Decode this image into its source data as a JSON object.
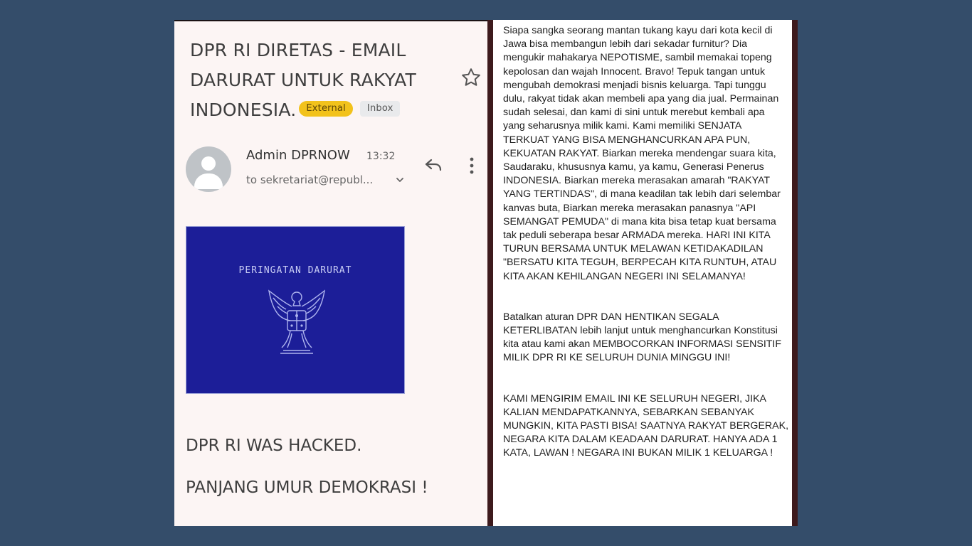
{
  "email": {
    "subject_lines": [
      "DPR RI DIRETAS - EMAIL",
      "DARURAT UNTUK RAKYAT",
      "INDONESIA."
    ],
    "label_external": "External",
    "label_inbox": "Inbox",
    "sender_name": "Admin DPRNOW",
    "time": "13:32",
    "recipient": "to sekretariat@republ...",
    "image_caption": "PERINGATAN DARURAT",
    "body_line1": "DPR RI WAS HACKED.",
    "body_line2": "PANJANG UMUR DEMOKRASI !"
  },
  "icons": {
    "star": "star-icon",
    "reply": "reply-icon",
    "more": "more-vertical-icon",
    "expand": "chevron-down-icon",
    "avatar": "avatar-placeholder"
  },
  "colors": {
    "background": "#344d6a",
    "external_badge": "#f2c21b",
    "warning_blue": "#1c1e98"
  },
  "manifesto": {
    "paragraph1": "Siapa sangka seorang mantan tukang kayu dari kota kecil di Jawa bisa membangun lebih dari sekadar furnitur? Dia mengukir mahakarya NEPOTISME, sambil memakai topeng kepolosan dan wajah Innocent. Bravo! Tepuk tangan untuk mengubah demokrasi menjadi bisnis keluarga. Tapi tunggu dulu, rakyat tidak akan membeli apa yang dia jual. Permainan sudah selesai, dan kami di sini untuk merebut kembali apa yang seharusnya milik kami. Kami memiliki SENJATA TERKUAT YANG BISA MENGHANCURKAN APA PUN, KEKUATAN RAKYAT. Biarkan mereka mendengar suara kita, Saudaraku, khususnya kamu, ya kamu, Generasi Penerus INDONESIA. Biarkan mereka merasakan amarah \"RAKYAT YANG TERTINDAS\", di mana keadilan tak lebih dari selembar kanvas buta, Biarkan mereka merasakan panasnya \"API SEMANGAT PEMUDA\" di mana kita bisa tetap kuat bersama tak peduli seberapa besar ARMADA mereka. HARI INI KITA TURUN BERSAMA UNTUK MELAWAN KETIDAKADILAN \"BERSATU KITA TEGUH, BERPECAH KITA RUNTUH, ATAU KITA AKAN KEHILANGAN NEGERI INI SELAMANYA!",
    "paragraph2": "Batalkan aturan DPR DAN HENTIKAN SEGALA KETERLIBATAN lebih lanjut untuk menghancurkan Konstitusi kita atau kami akan MEMBOCORKAN INFORMASI SENSITIF MILIK DPR RI KE SELURUH DUNIA MINGGU INI!",
    "paragraph3": "KAMI MENGIRIM EMAIL INI KE SELURUH NEGERI, JIKA KALIAN MENDAPATKANNYA, SEBARKAN SEBANYAK MUNGKIN, KITA PASTI BISA! SAATNYA RAKYAT BERGERAK, NEGARA KITA DALAM KEADAAN DARURAT. HANYA ADA 1 KATA, LAWAN ! NEGARA INI BUKAN MILIK 1 KELUARGA !"
  }
}
